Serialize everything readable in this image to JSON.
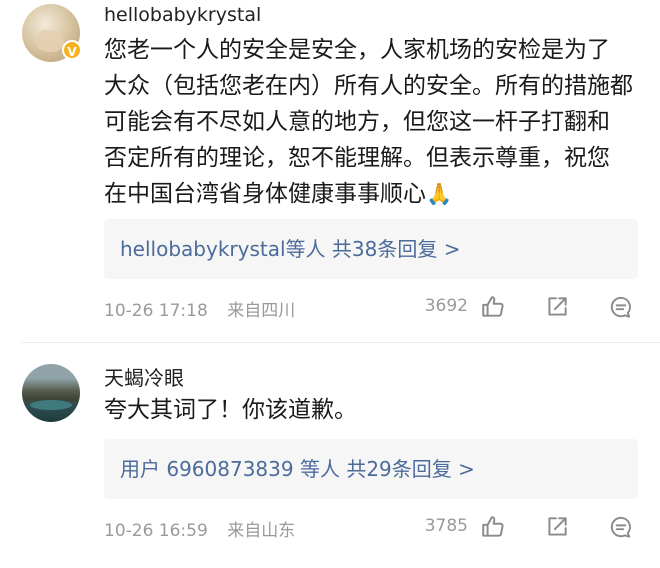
{
  "comments": [
    {
      "username": "hellobabykrystal",
      "verified_badge": "v-badge-icon",
      "text_lines": [
        "您老一个人的安全是安全，人家机场的安检是为了",
        "大众（包括您老在内）所有人的安全。所有的措施都",
        "可能会有不尽如人意的地方，但您这一杆子打翻和",
        "否定所有的理论，恕不能理解。但表示尊重，祝您",
        "在中国台湾省身体健康事事顺心"
      ],
      "emoji": "🙏",
      "reply_summary": "hellobabykrystal等人 共38条回复 >",
      "time": "10-26 17:18",
      "location": "来自四川",
      "like_count": "3692"
    },
    {
      "username": "天蝎冷眼",
      "text_lines": [
        "夸大其词了！你该道歉。"
      ],
      "reply_summary": "用户 6960873839 等人 共29条回复 >",
      "time": "10-26 16:59",
      "location": "来自山东",
      "like_count": "3785"
    }
  ],
  "icons": {
    "like": "thumbs-up-icon",
    "share": "share-icon",
    "comment": "comment-icon"
  },
  "colors": {
    "link": "#4c6b9a",
    "meta": "#9a9a9a",
    "badge": "#f4b21c",
    "reply_bg": "#f6f6f7"
  }
}
